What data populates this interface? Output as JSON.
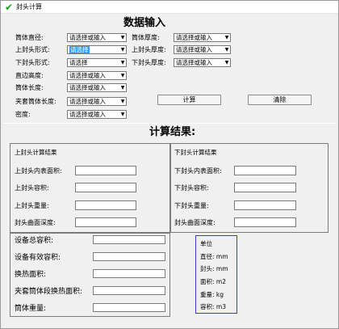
{
  "window": {
    "title": "封头计算",
    "icon": "check-icon"
  },
  "input_section": {
    "title": "数据输入",
    "left_fields": [
      {
        "label": "筒体直径:",
        "value": "请选择或输入",
        "selected": false
      },
      {
        "label": "上封头形式:",
        "value": "请选择",
        "selected": true
      },
      {
        "label": "下封头形式:",
        "value": "请选择",
        "selected": false
      },
      {
        "label": "直边高度:",
        "value": "请选择或输入",
        "selected": false
      },
      {
        "label": "筒体长度:",
        "value": "请选择或输入",
        "selected": false
      },
      {
        "label": "夹套筒体长度:",
        "value": "请选择或输入",
        "selected": false
      },
      {
        "label": "密度:",
        "value": "请选择或输入",
        "selected": false
      }
    ],
    "right_fields": [
      {
        "label": "筒体厚度:",
        "value": "请选择或输入"
      },
      {
        "label": "上封头厚度:",
        "value": "请选择或输入"
      },
      {
        "label": "下封头厚度:",
        "value": "请选择或输入"
      }
    ],
    "calc_button": "计算",
    "clear_button": "清除"
  },
  "results_section": {
    "title": "计算结果:",
    "upper_head": {
      "group_title": "上封头计算结果",
      "fields": [
        "上封头内表面积:",
        "上封头容积:",
        "上封头重量:",
        "封头曲面深度:"
      ]
    },
    "lower_head": {
      "group_title": "下封头计算结果",
      "fields": [
        "下封头内表面积:",
        "下封头容积:",
        "下封头重量:",
        "封头曲面深度:"
      ]
    },
    "totals": {
      "fields": [
        "设备总容积:",
        "设备有效容积:",
        "换热面积:",
        "夹套筒体段换热面积:",
        "筒体重量:"
      ]
    },
    "units": {
      "title": "单位",
      "lines": [
        "直径: mm",
        "封头: mm",
        "面积: m2",
        "重量: kg",
        "容积: m3"
      ]
    }
  }
}
